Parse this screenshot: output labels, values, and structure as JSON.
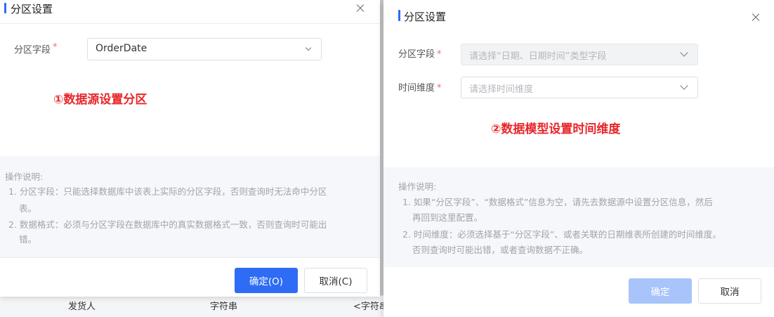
{
  "background_table": {
    "cells": [
      "发货人",
      "字符串",
      "<字符串"
    ]
  },
  "dialog1": {
    "title": "分区设置",
    "field_label": "分区字段",
    "required_mark": "*",
    "field_value": "OrderDate",
    "annotation": "①数据源设置分区",
    "help": {
      "title": "操作说明:",
      "items": [
        "1. 分区字段：只能选择数据库中该表上实际的分区字段，否则查询时无法命中分区",
        "表。",
        "2. 数据格式：必须与分区字段在数据库中的真实数据格式一致，否则查询时可能出",
        "错。"
      ]
    },
    "confirm_label": "确定(O)",
    "cancel_label": "取消(C)"
  },
  "dialog2": {
    "title": "分区设置",
    "partition_label": "分区字段",
    "partition_placeholder": "请选择“日期、日期时间”类型字段",
    "time_dim_label": "时间维度",
    "time_dim_placeholder": "请选择时间维度",
    "required_mark": "*",
    "annotation": "②数据模型设置时间维度",
    "help": {
      "title": "操作说明:",
      "items": [
        "1. 如果“分区字段”、“数据格式”信息为空，请先去数据源中设置分区信息，然后",
        "再回到这里配置。",
        "2. 时间维度：必须选择基于“分区字段”、或者关联的日期维表所创建的时间维度。",
        "否则查询时可能出错，或者查询数据不正确。"
      ]
    },
    "confirm_label": "确定",
    "cancel_label": "取消"
  },
  "colors": {
    "primary": "#2e6cf6",
    "primary_disabled": "#a8c4fb",
    "annotation_red": "#e8262a",
    "required_red": "#f56c6c"
  },
  "icons": [
    "close-icon",
    "chevron-down-icon"
  ]
}
